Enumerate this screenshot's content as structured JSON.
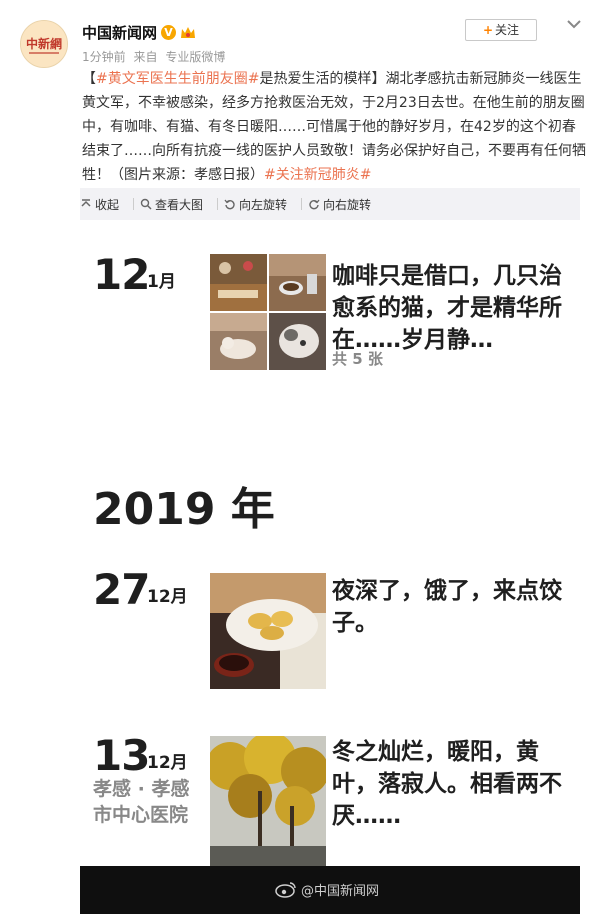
{
  "post": {
    "author_name": "中国新闻网",
    "verified_glyph": "V",
    "avatar_logo_text": "中新網",
    "time": "1分钟前",
    "source_prefix": "来自",
    "source": "专业版微博",
    "follow_label": "关注",
    "text_open": "【",
    "hashtag_1": "#黄文军医生生前朋友圈#",
    "text_main": "是热爱生活的模样】湖北孝感抗击新冠肺炎一线医生黄文军，不幸被感染，经多方抢救医治无效，于2月23日去世。在他生前的朋友圈中，有咖啡、有猫、有冬日暖阳……可惜属于他的静好岁月，在42岁的这个初春结束了……向所有抗疫一线的医护人员致敬！请务必保护好自己，不要再有任何牺牲！（图片来源：孝感日报）",
    "hashtag_2": "#关注新冠肺炎#"
  },
  "media_toolbar": {
    "collapse": "收起",
    "view_large": "查看大图",
    "rotate_left": "向左旋转",
    "rotate_right": "向右旋转"
  },
  "photo": {
    "entry1": {
      "day": "12",
      "month": "1月",
      "caption": "咖啡只是借口，几只治愈系的猫，才是精华所在……岁月静…",
      "count": "共 5 张"
    },
    "year": "2019 年",
    "entry2": {
      "day": "27",
      "month": "12月",
      "caption": "夜深了，饿了，来点饺子。"
    },
    "entry3": {
      "day": "13",
      "month": "12月",
      "location": "孝感 · 孝感市中心医院",
      "caption": "冬之灿烂，暖阳，黄叶，落寂人。相看两不厌……"
    },
    "watermark": "@中国新闻网"
  },
  "colors": {
    "link": "#eb7350",
    "follow_plus": "#ff8200",
    "verified": "#f8a600"
  }
}
